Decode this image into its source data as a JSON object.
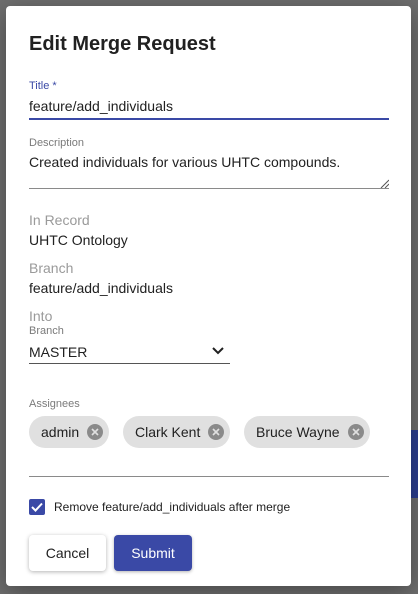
{
  "dialog": {
    "title": "Edit Merge Request",
    "title_field": {
      "label": "Title *",
      "value": "feature/add_individuals"
    },
    "description_field": {
      "label": "Description",
      "value": "Created individuals for various UHTC compounds."
    },
    "in_record": {
      "label": "In Record",
      "value": "UHTC Ontology"
    },
    "branch": {
      "label": "Branch",
      "value": "feature/add_individuals"
    },
    "into": {
      "label": "Into",
      "branch_label": "Branch",
      "selected": "MASTER"
    },
    "assignees": {
      "label": "Assignees",
      "chips": [
        "admin",
        "Clark Kent",
        "Bruce Wayne"
      ]
    },
    "remove_checkbox": {
      "label": "Remove feature/add_individuals after merge",
      "checked": true
    },
    "cancel_label": "Cancel",
    "submit_label": "Submit"
  },
  "colors": {
    "accent": "#3a49a6",
    "chip": "#e0e0e0"
  },
  "icons": [
    "chevron-down-icon",
    "close-circle-icon",
    "check-icon",
    "resize-grip-icon"
  ]
}
